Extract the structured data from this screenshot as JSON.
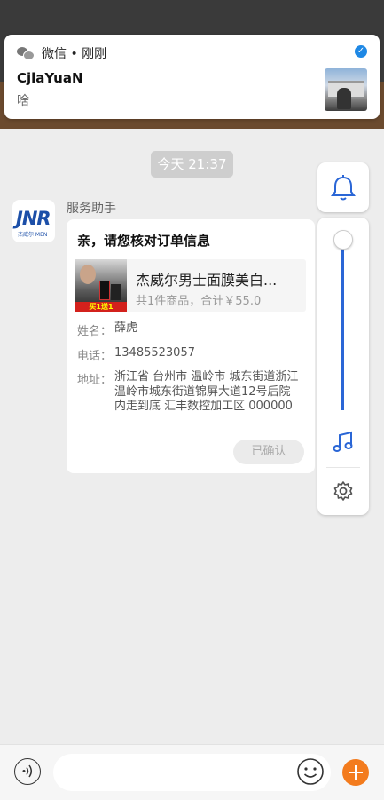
{
  "notification": {
    "app_label": "微信 • 刚刚",
    "sender": "CjlaYuaN",
    "message": "啥",
    "verified_mark": "✓"
  },
  "chat": {
    "time": "今天  21:37",
    "sender_name": "服务助手",
    "avatar_logo": "JNR",
    "avatar_sub": "杰威尔 MEN",
    "card": {
      "title": "亲，请您核对订单信息",
      "product_name": "杰威尔男士面膜美白...",
      "product_summary": "共1件商品，合计￥55.0",
      "product_badge": "买1送1",
      "name_label": "姓名：",
      "name_value": "薛虎",
      "phone_label": "电话：",
      "phone_value": "13485523057",
      "address_label": "地址：",
      "address_value": "浙江省 台州市 温岭市 城东街道浙江温岭市城东街道锦屏大道12号后院内走到底   汇丰数控加工区 000000",
      "confirm_button": "已确认"
    }
  },
  "floating": {
    "accent": "#2a66d6",
    "volume_level": 1.0
  },
  "input": {
    "placeholder": ""
  },
  "colors": {
    "plus_button": "#f37b1d",
    "background": "#ededed"
  },
  "icons": [
    "wechat-icon",
    "verified-icon",
    "bell-icon",
    "music-note-icon",
    "gear-icon",
    "voice-icon",
    "emoji-icon",
    "plus-icon"
  ]
}
